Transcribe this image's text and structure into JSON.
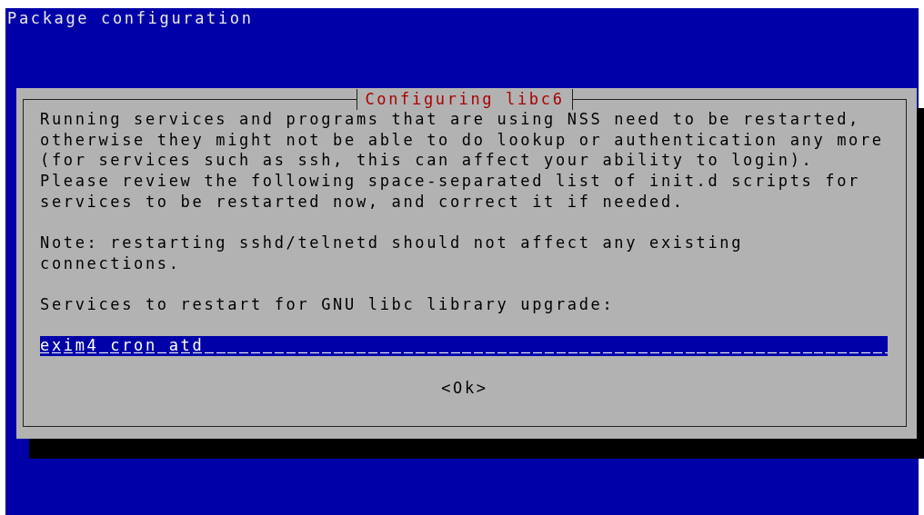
{
  "screen": {
    "title": "Package configuration"
  },
  "dialog": {
    "title": "Configuring libc6",
    "paragraphs": [
      "Running services and programs that are using NSS need to be restarted,\notherwise they might not be able to do lookup or authentication any more\n(for services such as ssh, this can affect your ability to login).\nPlease review the following space-separated list of init.d scripts for\nservices to be restarted now, and correct it if needed.",
      "Note: restarting sshd/telnetd should not affect any existing\nconnections.",
      "Services to restart for GNU libc library upgrade:"
    ],
    "field": {
      "value": "exim4 cron atd",
      "focused": true
    },
    "buttons": [
      {
        "label": "<Ok>",
        "focused": false
      }
    ]
  }
}
